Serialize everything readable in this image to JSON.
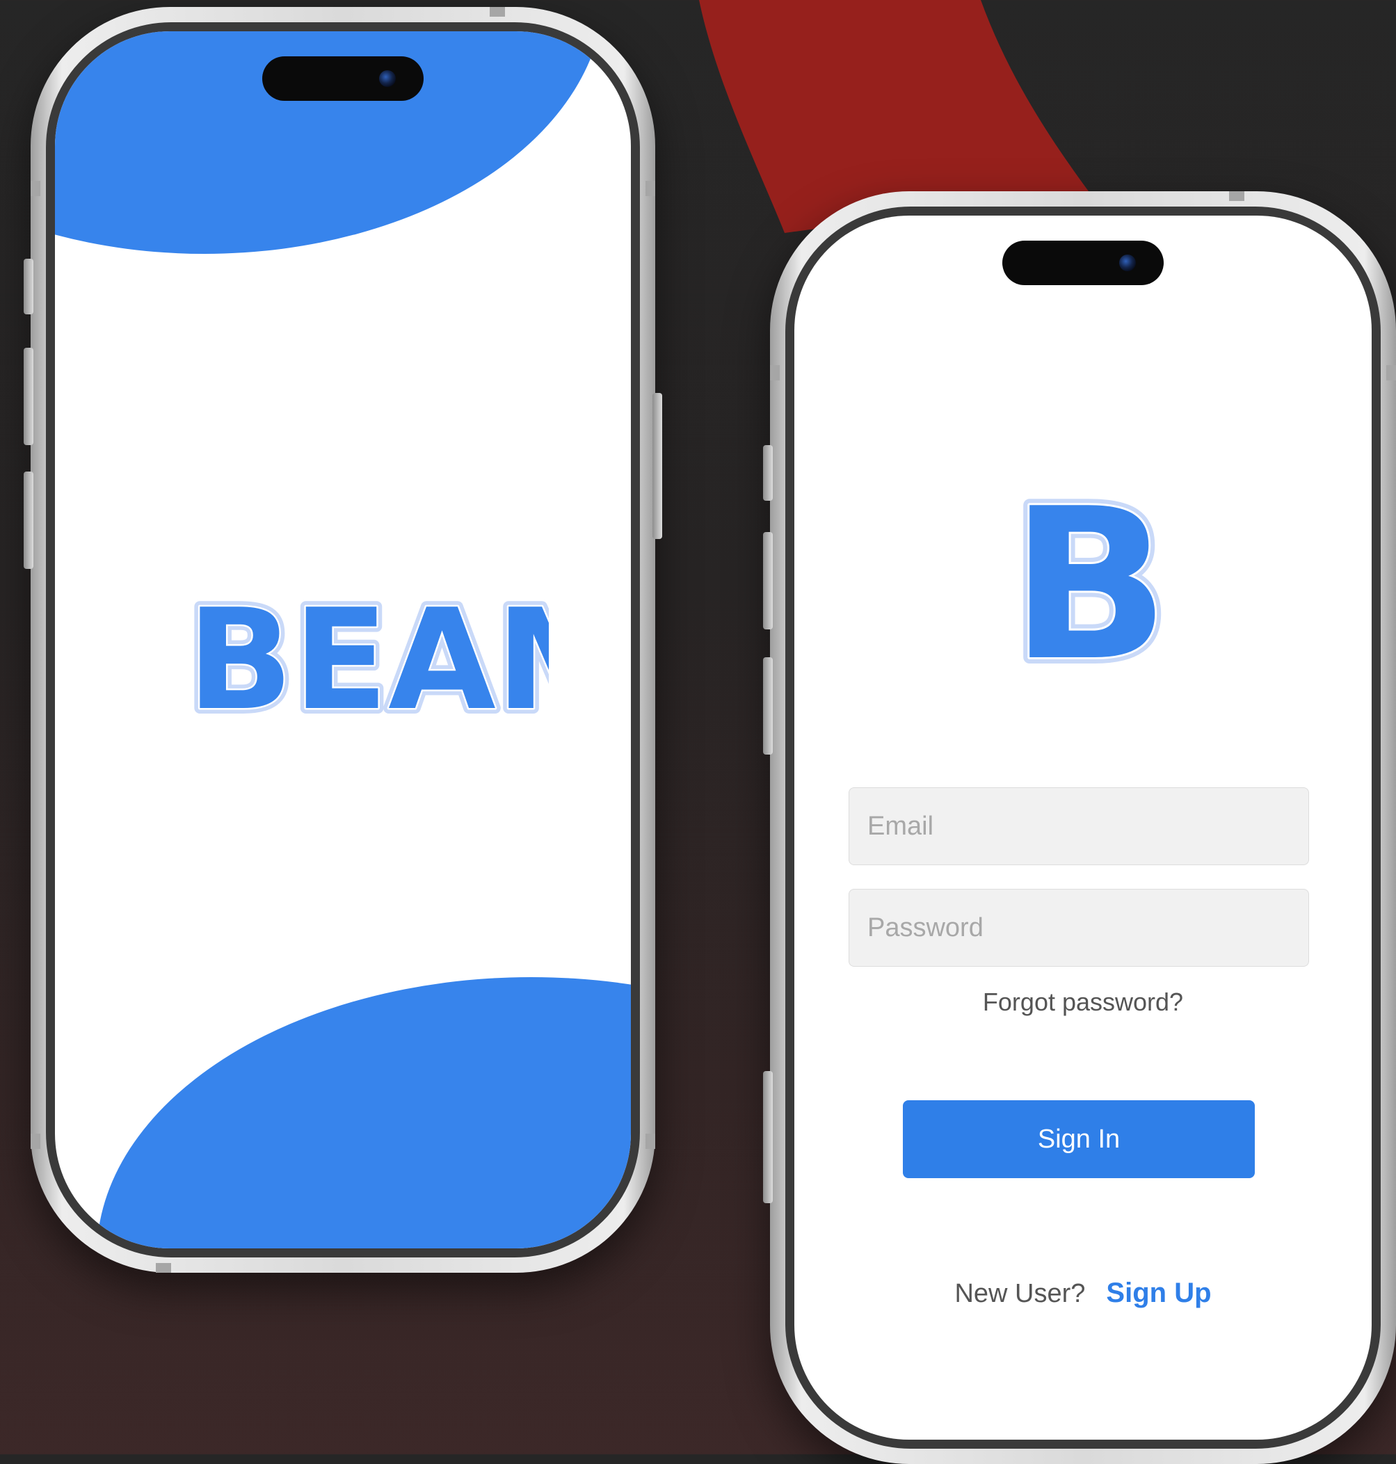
{
  "splash": {
    "logo_text": "BEAM"
  },
  "login": {
    "logo_letter": "B",
    "email_placeholder": "Email",
    "password_placeholder": "Password",
    "forgot_label": "Forgot password?",
    "signin_label": "Sign In",
    "new_user_label": "New User?",
    "signup_label": "Sign Up"
  },
  "colors": {
    "brand_blue": "#3784ec",
    "button_blue": "#2f7fe8",
    "background": "#262626",
    "accent_red": "#96201c"
  }
}
